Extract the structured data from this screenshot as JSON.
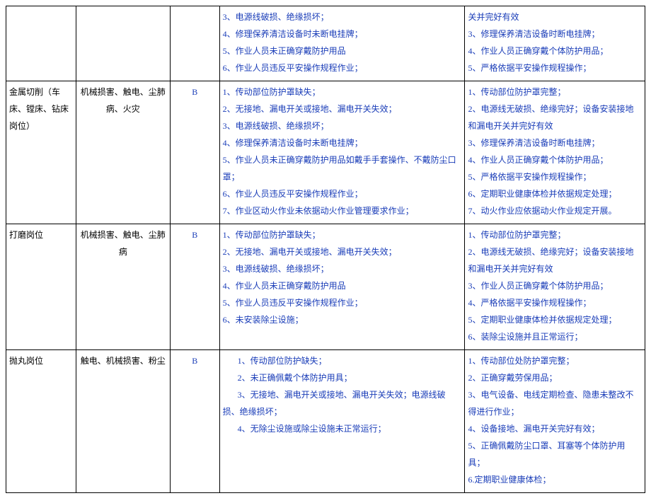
{
  "rows": [
    {
      "c0": "",
      "c1": "",
      "c2": "",
      "haz": [
        "3、电源线破损、绝缘损坏；",
        "4、修理保养清洁设备时未断电挂牌；",
        "5、作业人员未正确穿戴防护用品",
        "6、作业人员违反平安操作规程作业；"
      ],
      "meas": [
        "关并完好有效",
        "3、修理保养清洁设备时断电挂牌；",
        "4、作业人员正确穿戴个体防护用品；",
        "5、严格依据平安操作规程操作；"
      ]
    },
    {
      "c0": "金属切削（车床、镗床、钻床岗位）",
      "c1": "机械损害、触电、尘肺病、火灾",
      "c2": "B",
      "haz": [
        "1、传动部位防护罩缺失；",
        "2、无接地、漏电开关或接地、漏电开关失效；",
        "3、电源线破损、绝缘损坏；",
        "4、修理保养清洁设备时未断电挂牌；",
        "5、作业人员未正确穿戴防护用品如戴手手套操作、不戴防尘口罩；",
        "6、作业人员违反平安操作规程作业；",
        "7、作业区动火作业未依据动火作业管理要求作业；"
      ],
      "meas": [
        "1、传动部位防护罩完整；",
        "2、电源线无破损、绝缘完好；设备安装接地和漏电开关并完好有效",
        "3、修理保养清洁设备时断电挂牌；",
        "4、作业人员正确穿戴个体防护用品；",
        "5、严格依据平安操作规程操作；",
        "6、定期职业健康体检并依据规定处理；",
        "7、动火作业应依据动火作业规定开展。"
      ]
    },
    {
      "c0": "打磨岗位",
      "c1": "机械损害、触电、尘肺病",
      "c2": "B",
      "haz": [
        "1、传动部位防护罩缺失；",
        "2、无接地、漏电开关或接地、漏电开关失效；",
        "3、电源线破损、绝缘损坏；",
        "4、作业人员未正确穿戴防护用品",
        "5、作业人员违反平安操作规程作业；",
        "  6、未安装除尘设施；"
      ],
      "meas": [
        "1、传动部位防护罩完整；",
        "2、电源线无破损、绝缘完好；设备安装接地和漏电开关并完好有效",
        "3、作业人员正确穿戴个体防护用品；",
        "4、严格依据平安操作规程操作；",
        "5、定期职业健康体检并依据规定处理；",
        "6、装除尘设施并且正常运行；"
      ]
    },
    {
      "c0": "抛丸岗位",
      "c1": "触电、机械损害、粉尘",
      "c2": "B",
      "haz_indent": true,
      "haz": [
        "1、传动部位防护缺失；",
        "2、未正确佩戴个体防护用具；",
        "3、无接地、漏电开关或接地、漏电开关失效；电源线破损、绝缘损坏；",
        "4、无除尘设施或除尘设施未正常运行；"
      ],
      "meas": [
        "1、传动部位处防护罩完整；",
        "2、正确穿戴劳保用品；",
        "3、电气设备、电线定期检查、隐患未整改不得进行作业；",
        "4、设备接地、漏电开关完好有效；",
        "5、正确佩戴防尘口罩、耳塞等个体防护用具；",
        "6.定期职业健康体检；"
      ]
    }
  ]
}
